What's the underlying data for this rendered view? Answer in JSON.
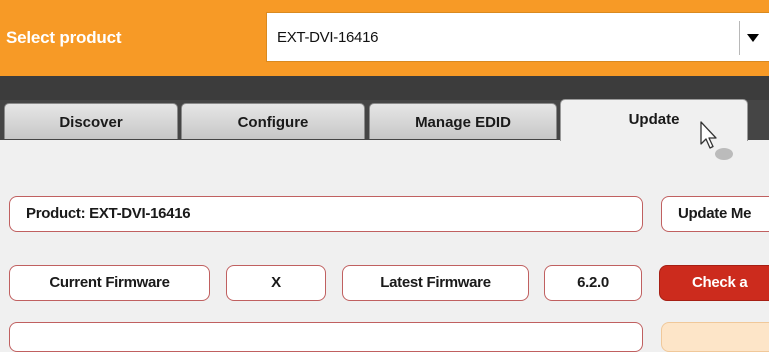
{
  "header": {
    "select_label": "Select product",
    "selected_product": "EXT-DVI-16416"
  },
  "tabs": [
    {
      "label": "Discover",
      "active": false
    },
    {
      "label": "Configure",
      "active": false
    },
    {
      "label": "Manage EDID",
      "active": false
    },
    {
      "label": "Update",
      "active": true
    }
  ],
  "update": {
    "product_text": "Product: EXT-DVI-16416",
    "update_mode_button": "Update Me",
    "current_firmware_label": "Current Firmware",
    "current_firmware_value": "X",
    "latest_firmware_label": "Latest Firmware",
    "latest_firmware_value": "6.2.0",
    "check_button": "Check a"
  },
  "colors": {
    "accent": "#f79a26",
    "tab_strip": "#454545",
    "button_red": "#cc2b1d",
    "field_border": "#c06060"
  }
}
